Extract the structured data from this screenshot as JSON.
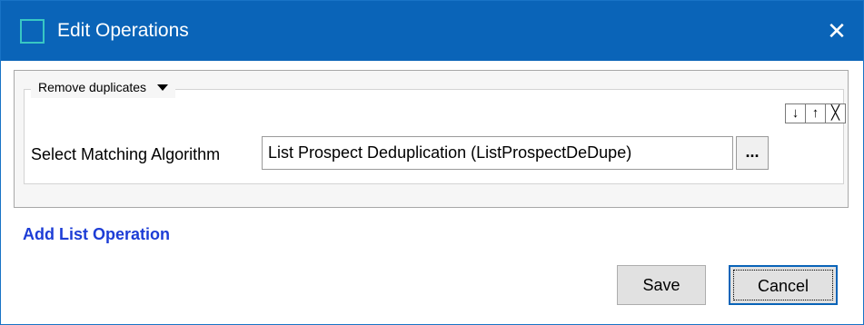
{
  "window": {
    "title": "Edit Operations",
    "close_glyph": "✕"
  },
  "operation": {
    "name": "Remove duplicates",
    "controls": {
      "move_down": "↓",
      "move_up": "↑",
      "remove": "╳"
    },
    "field_label": "Select Matching Algorithm",
    "field_value": "List Prospect Deduplication (ListProspectDeDupe)",
    "browse_label": "..."
  },
  "add_link": "Add List Operation",
  "buttons": {
    "save": "Save",
    "cancel": "Cancel"
  },
  "colors": {
    "titlebar": "#0a64b8",
    "link": "#1d3dd6"
  }
}
